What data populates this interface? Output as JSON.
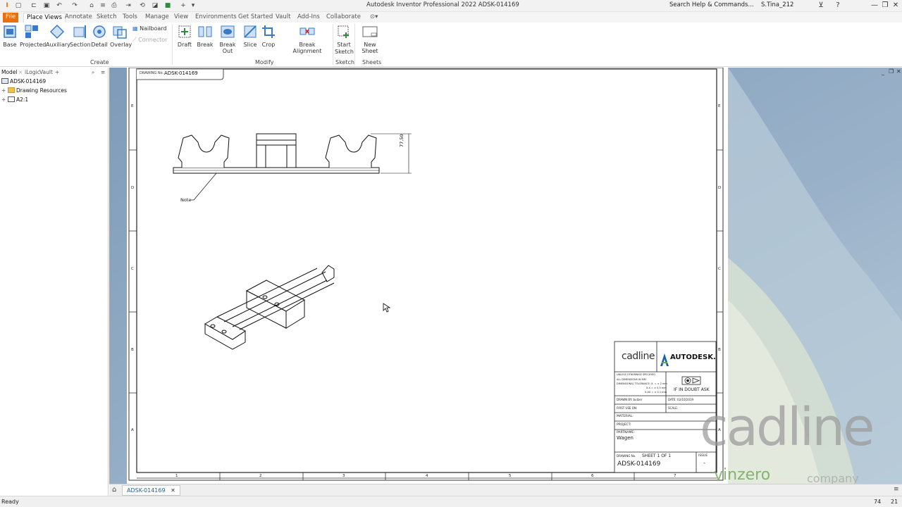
{
  "titlebar": {
    "app_title": "Autodesk Inventor Professional 2022   ADSK-014169",
    "search_placeholder": "Search Help & Commands...",
    "user": "S.Tina_212"
  },
  "ribbon_tabs": [
    "File",
    "Place Views",
    "Annotate",
    "Sketch",
    "Tools",
    "Manage",
    "View",
    "Environments",
    "Get Started",
    "Vault",
    "Add-Ins",
    "Collaborate"
  ],
  "active_tab": "Place Views",
  "ribbon": {
    "create_buttons": [
      "Base",
      "Projected",
      "Auxiliary",
      "Section",
      "Detail",
      "Overlay"
    ],
    "nailboard": "Nailboard",
    "connector": "Connector",
    "create_label": "Create",
    "modify_buttons": [
      "Draft",
      "Break",
      "Break Out",
      "Slice",
      "Crop"
    ],
    "break_alignment": "Break Alignment",
    "modify_label": "Modify",
    "start_sketch_line1": "Start",
    "start_sketch_line2": "Sketch",
    "sketch_label": "Sketch",
    "new_sheet": "New Sheet",
    "sheets_label": "Sheets"
  },
  "browser": {
    "tabs": [
      "Model",
      "iLogic",
      "Vault"
    ],
    "add_tab": "+",
    "tree": [
      {
        "label": "ADSK-014169",
        "level": 0,
        "expander": ""
      },
      {
        "label": "Drawing Resources",
        "level": 1,
        "expander": "+"
      },
      {
        "label": "A2:1",
        "level": 1,
        "expander": "+"
      }
    ]
  },
  "drawing": {
    "drawing_no_tag": "DRAWING No.",
    "drawing_no": "ADSK-014169",
    "dimension": "77,50",
    "note": "Note",
    "zone_letters": [
      "E",
      "D",
      "C",
      "B",
      "A"
    ],
    "zone_numbers": [
      "1",
      "2",
      "3",
      "4",
      "5",
      "6",
      "7"
    ],
    "title_block": {
      "cadline": "cadline",
      "autodesk": "AUTODESK.",
      "unless": "UNLESS OTHERWISE SPECIFIED",
      "dims_mm": "ALL DIMENSIONS IN MM",
      "tolerance": "DIMENSIONAL TOLERANCE: X. = ± 2 mm",
      "tol1": "X.X = ± 0.5 mm",
      "tol2": "X.XX = ± 0.1 mm",
      "doubt": "IF IN DOUBT ASK",
      "drawn_by": "DRAWN BY: butzer",
      "date": "DATE: 02/10/2019",
      "first_use": "FIRST USE ON:",
      "scale": "SCALE:",
      "material": "MATERIAL:",
      "project": "PROJECT:",
      "part_name_label": "PARTNAME:",
      "part_name": "Wagen",
      "drawing_no_label": "DRAWING No.",
      "sheet": "SHEET 1 OF 1",
      "issue_label": "ISSUE",
      "issue": "-",
      "drawing_no": "ADSK-014169"
    }
  },
  "watermark": {
    "brand": "cadline",
    "sub": "vinzero",
    "tail": "company"
  },
  "document_tab": "ADSK-014169",
  "status": {
    "text": "Ready",
    "num1": "74",
    "num2": "21"
  },
  "colors": {
    "file_tab": "#e8700f",
    "canvas_bg": "#8ea6c0",
    "ribbon_icon_blue": "#3a7bc8",
    "watermark_green": "#6aa84f"
  }
}
